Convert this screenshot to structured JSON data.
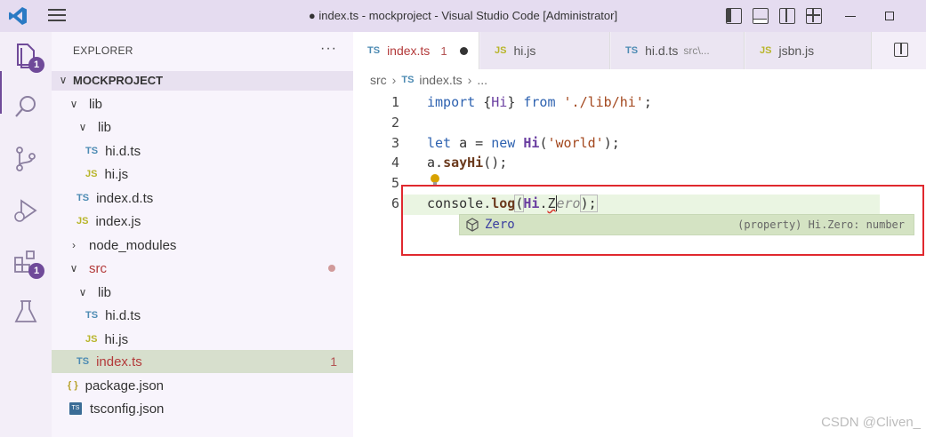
{
  "window": {
    "title": "● index.ts - mockproject - Visual Studio Code [Administrator]"
  },
  "activity_bar": {
    "explorer_badge": "1",
    "extensions_badge": "1"
  },
  "sidebar": {
    "header": "EXPLORER",
    "more": "···",
    "root": "MOCKPROJECT",
    "tree": [
      {
        "label": "lib",
        "type": "folder",
        "expanded": true
      },
      {
        "label": "lib",
        "type": "folder",
        "expanded": true
      },
      {
        "label": "hi.d.ts",
        "type": "ts",
        "icon": "TS"
      },
      {
        "label": "hi.js",
        "type": "js",
        "icon": "JS"
      },
      {
        "label": "index.d.ts",
        "type": "ts",
        "icon": "TS"
      },
      {
        "label": "index.js",
        "type": "js",
        "icon": "JS"
      },
      {
        "label": "node_modules",
        "type": "folder",
        "expanded": false
      },
      {
        "label": "src",
        "type": "folder",
        "expanded": true
      },
      {
        "label": "lib",
        "type": "folder",
        "expanded": true
      },
      {
        "label": "hi.d.ts",
        "type": "ts",
        "icon": "TS"
      },
      {
        "label": "hi.js",
        "type": "js",
        "icon": "JS"
      },
      {
        "label": "index.ts",
        "type": "ts",
        "icon": "TS",
        "selected": true,
        "problems": "1"
      },
      {
        "label": "package.json",
        "type": "json",
        "icon": "{ }"
      },
      {
        "label": "tsconfig.json",
        "type": "tsconfig",
        "icon": "TS"
      }
    ]
  },
  "tabs": [
    {
      "label": "index.ts",
      "icon": "TS",
      "problems": "1",
      "active": true
    },
    {
      "label": "hi.js",
      "icon": "JS"
    },
    {
      "label": "hi.d.ts",
      "icon": "TS",
      "desc": "src\\..."
    },
    {
      "label": "jsbn.js",
      "icon": "JS"
    }
  ],
  "breadcrumb": {
    "folder": "src",
    "icon": "TS",
    "file": "index.ts",
    "rest": "..."
  },
  "editor": {
    "line_numbers": [
      "1",
      "2",
      "3",
      "4",
      "5",
      "6"
    ],
    "line1": {
      "import": "import",
      "open": " {",
      "Hi": "Hi",
      "close": "} ",
      "from": "from",
      "path": " './lib/hi'",
      "semi": ";"
    },
    "line3": {
      "let": "let",
      "decl": " a = ",
      "new": "new",
      "sp": " ",
      "Hi": "Hi",
      "open": "(",
      "arg": "'world'",
      "close": ");"
    },
    "line4": {
      "a": "a.",
      "sayHi": "sayHi",
      "rest": "();"
    },
    "line6": {
      "console": "console.",
      "log": "log",
      "open": "(",
      "Hi": "Hi",
      "dot": ".",
      "typed": "Z",
      "ghost": "ero",
      "close": ");"
    }
  },
  "suggest": {
    "label": "Zero",
    "detail": "(property) Hi.Zero: number"
  },
  "watermark": "CSDN @Cliven_"
}
